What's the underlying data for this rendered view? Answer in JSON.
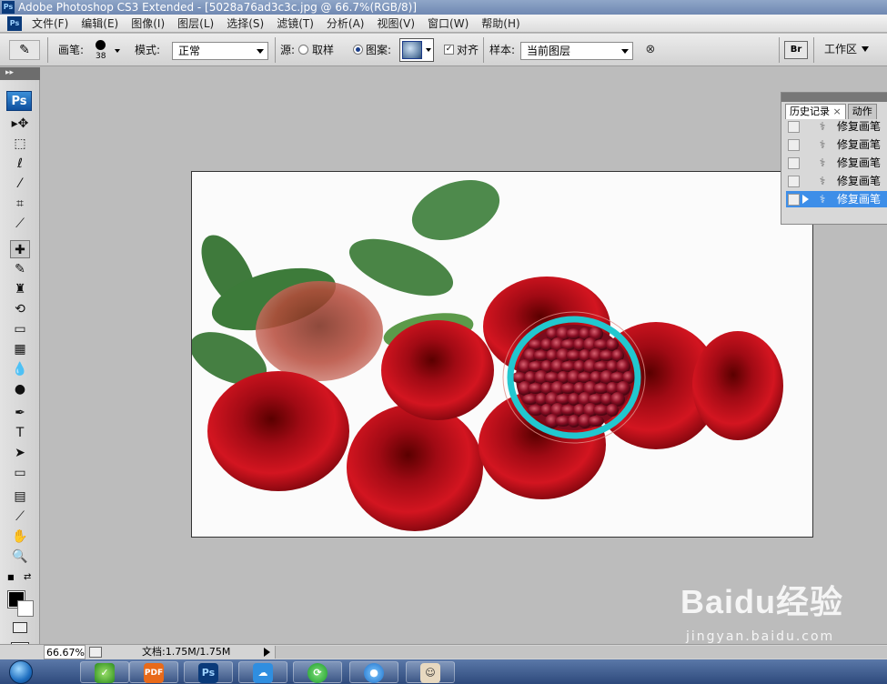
{
  "window": {
    "title": "Adobe Photoshop CS3 Extended - [5028a76ad3c3c.jpg @ 66.7%(RGB/8)]",
    "app_icon": "Ps"
  },
  "menu": {
    "items": [
      "文件(F)",
      "编辑(E)",
      "图像(I)",
      "图层(L)",
      "选择(S)",
      "滤镜(T)",
      "分析(A)",
      "视图(V)",
      "窗口(W)",
      "帮助(H)"
    ]
  },
  "options": {
    "brush_label": "画笔:",
    "brush_size": "38",
    "mode_label": "模式:",
    "mode_value": "正常",
    "source_label": "源:",
    "sampled_label": "取样",
    "pattern_label": "图案:",
    "aligned_label": "对齐",
    "sample_label": "样本:",
    "sample_value": "当前图层",
    "workspace_label": "工作区"
  },
  "toolbox": {
    "logo": "Ps",
    "tools": [
      {
        "name": "move-tool",
        "glyph": "▸✥"
      },
      {
        "name": "marquee-tool",
        "glyph": "⬚"
      },
      {
        "name": "lasso-tool",
        "glyph": "ℓ"
      },
      {
        "name": "magic-wand-tool",
        "glyph": "⁄"
      },
      {
        "name": "crop-tool",
        "glyph": "⌗"
      },
      {
        "name": "slice-tool",
        "glyph": "⟋"
      },
      {
        "name": "healing-brush-tool",
        "glyph": "✚",
        "active": true
      },
      {
        "name": "brush-tool",
        "glyph": "✎"
      },
      {
        "name": "clone-stamp-tool",
        "glyph": "♜"
      },
      {
        "name": "history-brush-tool",
        "glyph": "⟲"
      },
      {
        "name": "eraser-tool",
        "glyph": "▭"
      },
      {
        "name": "gradient-tool",
        "glyph": "▦"
      },
      {
        "name": "blur-tool",
        "glyph": "💧"
      },
      {
        "name": "dodge-tool",
        "glyph": "●"
      },
      {
        "name": "pen-tool",
        "glyph": "✒"
      },
      {
        "name": "type-tool",
        "glyph": "T"
      },
      {
        "name": "path-selection-tool",
        "glyph": "➤"
      },
      {
        "name": "shape-tool",
        "glyph": "▭"
      },
      {
        "name": "notes-tool",
        "glyph": "▤"
      },
      {
        "name": "eyedropper-tool",
        "glyph": "⟋"
      },
      {
        "name": "hand-tool",
        "glyph": "✋"
      },
      {
        "name": "zoom-tool",
        "glyph": "🔍"
      }
    ],
    "foreground": "#000000",
    "background": "#ffffff"
  },
  "history_panel": {
    "tabs": [
      "历史记录",
      "动作"
    ],
    "close_glyph": "×",
    "items": [
      {
        "label": "修复画笔",
        "selected": false
      },
      {
        "label": "修复画笔",
        "selected": false
      },
      {
        "label": "修复画笔",
        "selected": false
      },
      {
        "label": "修复画笔",
        "selected": false
      },
      {
        "label": "修复画笔",
        "selected": true
      }
    ]
  },
  "status": {
    "zoom": "66.67%",
    "doc": "文档:1.75M/1.75M"
  },
  "watermark": {
    "brand": "Baidu经验",
    "url": "jingyan.baidu.com"
  },
  "taskbar": {
    "apps": [
      "PDF",
      "Ps"
    ]
  },
  "colors": {
    "highlight_ring": "#22c7cf",
    "selection_blue": "#3d8ee8",
    "rose_red": "#c4121c"
  }
}
